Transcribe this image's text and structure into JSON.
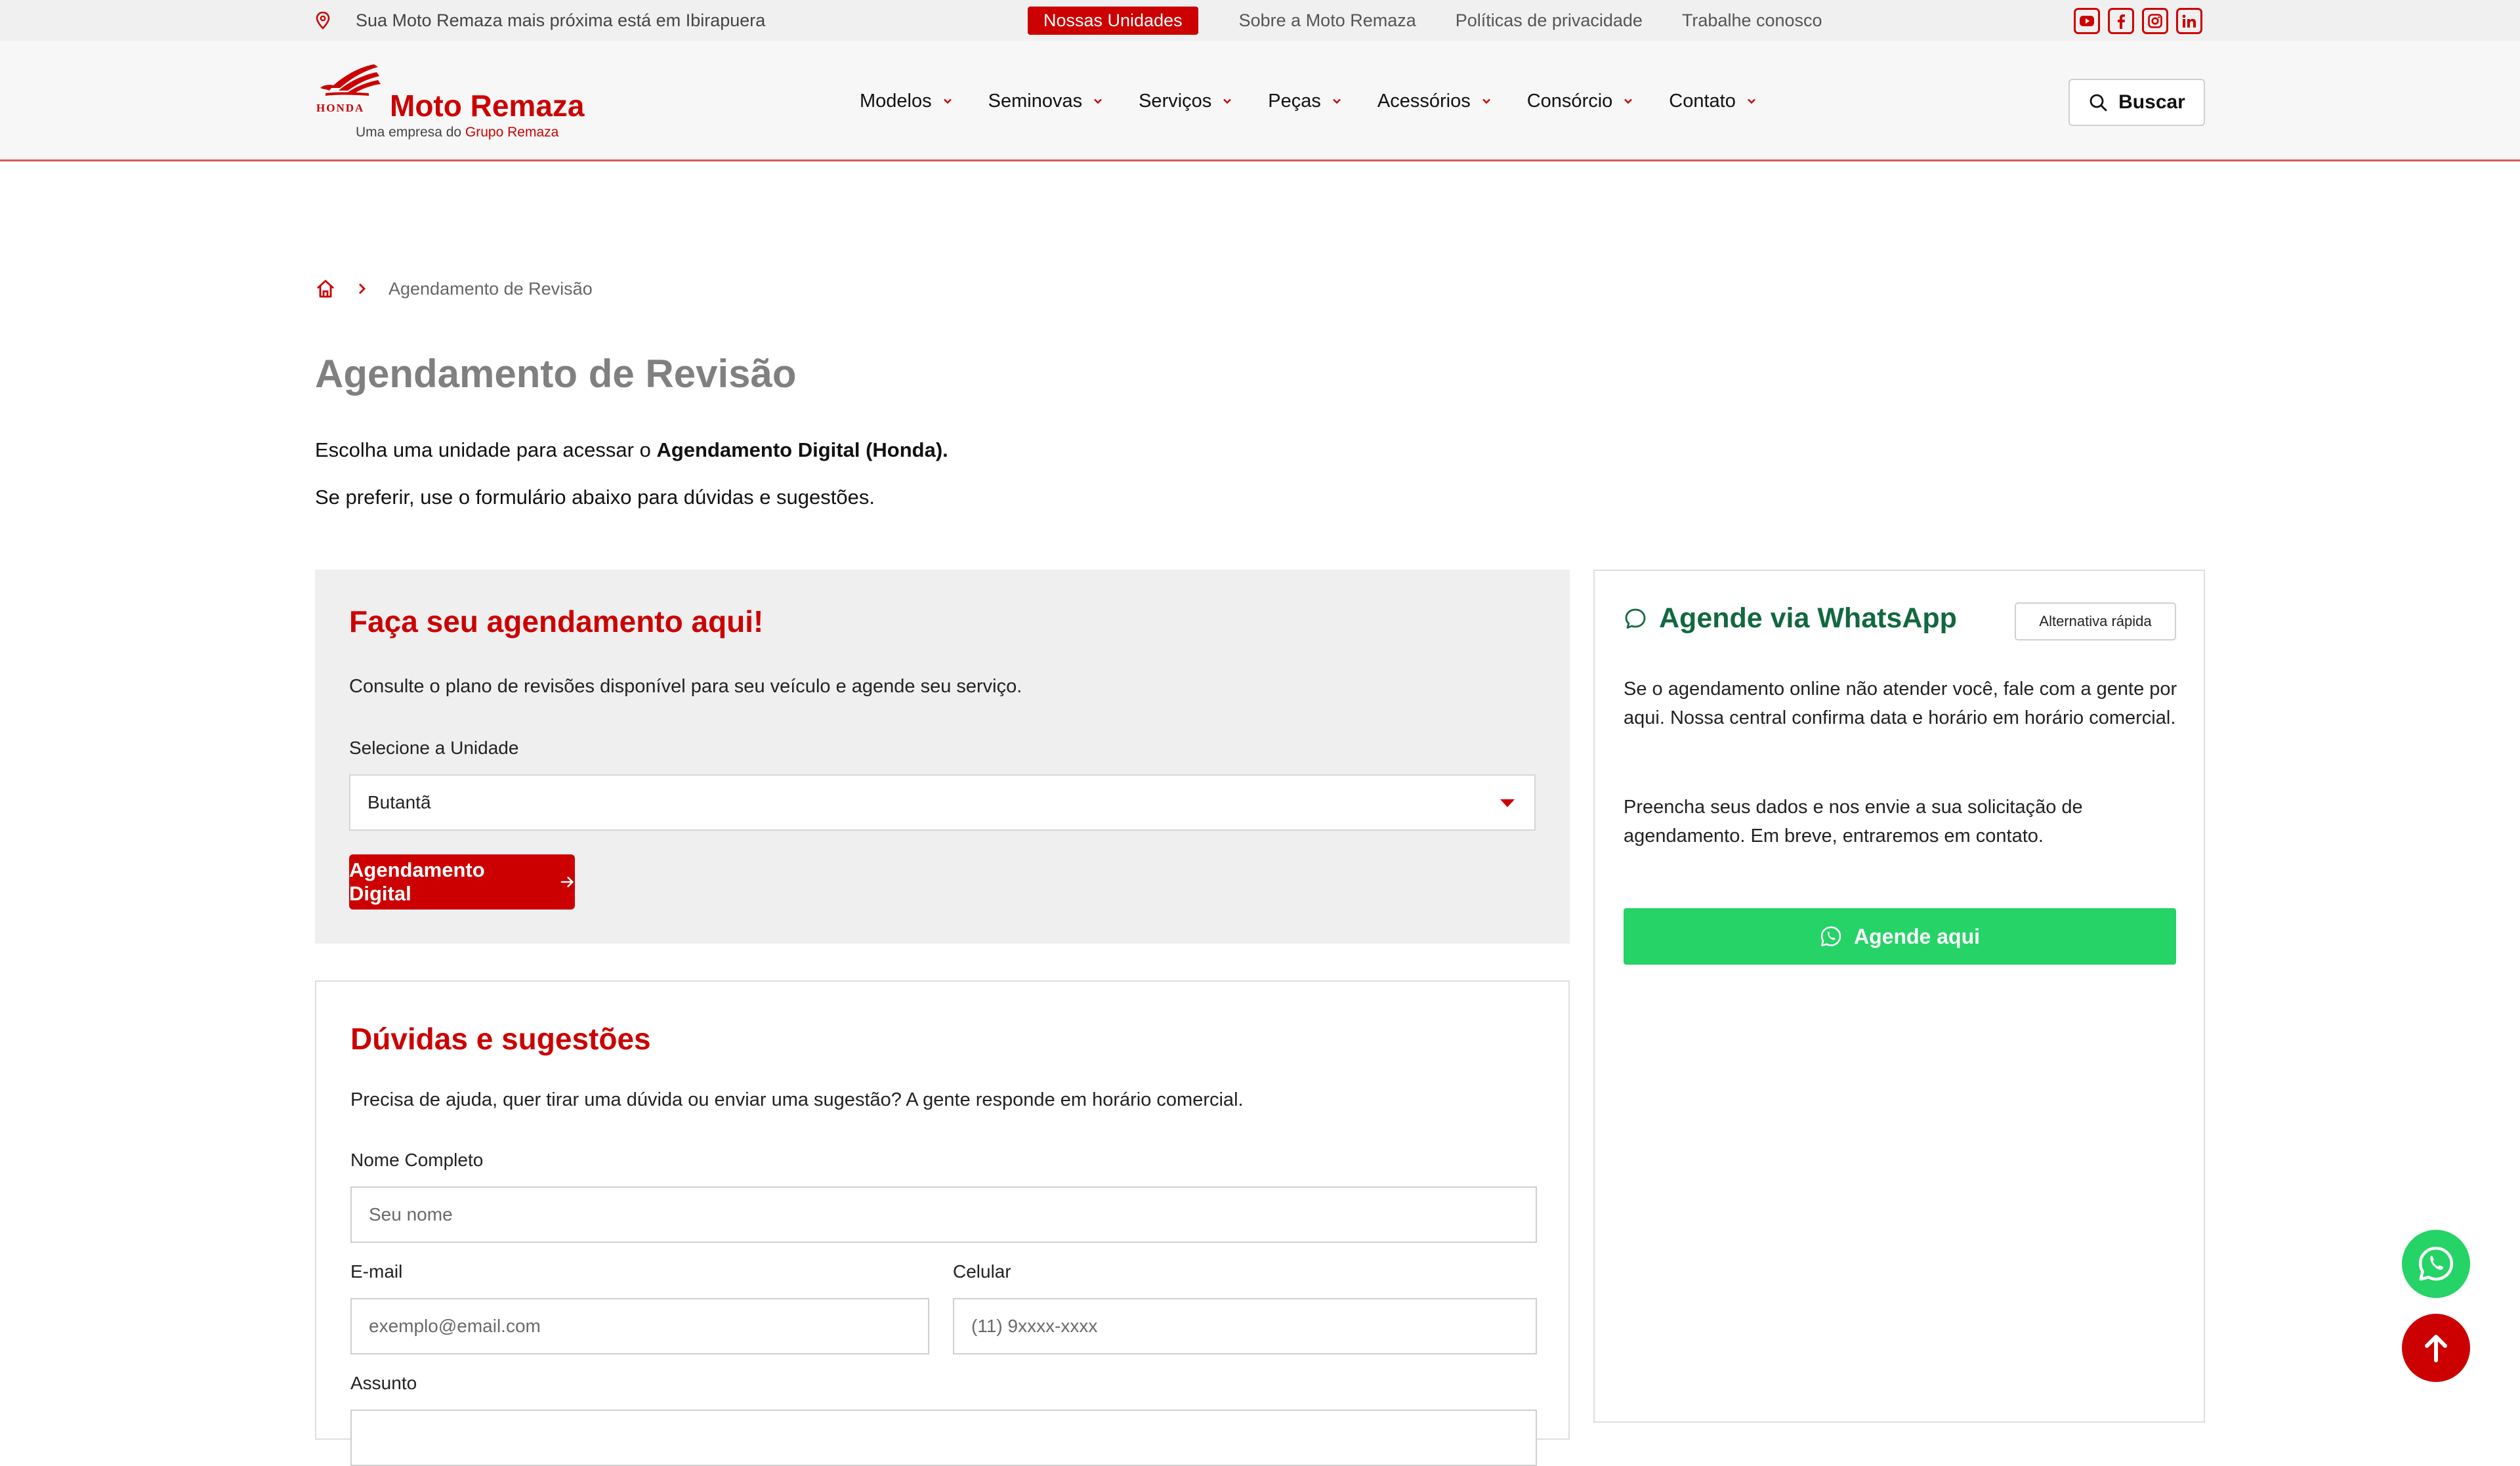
{
  "topbar": {
    "location_text": "Sua Moto Remaza mais próxima está em Ibirapuera",
    "highlight_link": "Nossas Unidades",
    "links": [
      "Sobre a Moto Remaza",
      "Políticas de privacidade",
      "Trabalhe conosco"
    ],
    "socials": [
      "youtube-icon",
      "facebook-icon",
      "instagram-icon",
      "linkedin-icon"
    ]
  },
  "header": {
    "logo_brand": "Moto Remaza",
    "logo_honda": "HONDA",
    "logo_sub_prefix": "Uma empresa do ",
    "logo_sub_highlight": "Grupo Remaza",
    "nav": [
      "Modelos",
      "Seminovas",
      "Serviços",
      "Peças",
      "Acessórios",
      "Consórcio",
      "Contato"
    ],
    "search_label": "Buscar"
  },
  "breadcrumb": {
    "current": "Agendamento de Revisão"
  },
  "page": {
    "title": "Agendamento de Revisão",
    "intro_prefix": "Escolha uma unidade para acessar o ",
    "intro_bold": "Agendamento Digital (Honda).",
    "intro2": "Se preferir, use o formulário abaixo para dúvidas e sugestões."
  },
  "schedule": {
    "title": "Faça seu agendamento aqui!",
    "description": "Consulte o plano de revisões disponível para seu veículo e agende seu serviço.",
    "select_label": "Selecione a Unidade",
    "selected_unit": "Butantã",
    "button_label": "Agendamento Digital"
  },
  "whatsapp": {
    "title": "Agende via WhatsApp",
    "tag": "Alternativa rápida",
    "paragraph1": "Se o agendamento online não atender você, fale com a gente por aqui. Nossa central confirma data e horário em horário comercial.",
    "paragraph2": "Preencha seus dados e nos envie a sua solicitação de agendamento. Em breve, entraremos em contato.",
    "button_label": "Agende aqui"
  },
  "contact": {
    "title": "Dúvidas e sugestões",
    "description": "Precisa de ajuda, quer tirar uma dúvida ou enviar uma sugestão? A gente responde em horário comercial.",
    "name_label": "Nome Completo",
    "name_placeholder": "Seu nome",
    "email_label": "E-mail",
    "email_placeholder": "exemplo@email.com",
    "phone_label": "Celular",
    "phone_placeholder": "(11) 9xxxx-xxxx",
    "subject_label": "Assunto"
  },
  "colors": {
    "brand_red": "#cc0000",
    "whatsapp_green": "#25d366",
    "whatsapp_title_green": "#12683f"
  }
}
